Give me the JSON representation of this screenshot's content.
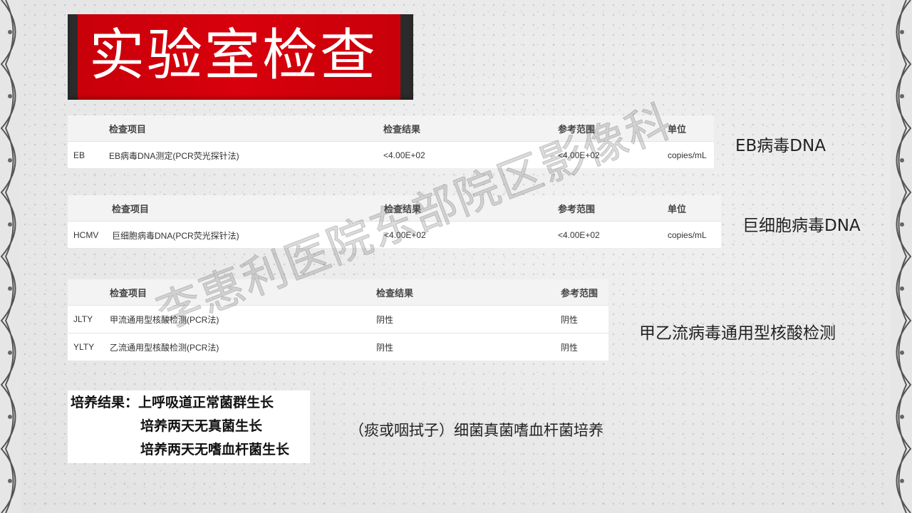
{
  "slide": {
    "title": "实验室检查",
    "watermark": "李惠利医院东部院区影像科"
  },
  "tables": {
    "eb": {
      "headers": [
        "检查项目",
        "检查结果",
        "参考范围",
        "单位"
      ],
      "rows": [
        {
          "code": "EB",
          "item": "EB病毒DNA测定(PCR荧光探针法)",
          "result": "<4.00E+02",
          "range": "<4.00E+02",
          "unit": "copies/mL"
        }
      ],
      "side_label": "EB病毒DNA"
    },
    "hcmv": {
      "headers": [
        "检查项目",
        "检查结果",
        "参考范围",
        "单位"
      ],
      "rows": [
        {
          "code": "HCMV",
          "item": "巨细胞病毒DNA(PCR荧光探针法)",
          "result": "<4.00E+02",
          "range": "<4.00E+02",
          "unit": "copies/mL"
        }
      ],
      "side_label": "巨细胞病毒DNA"
    },
    "flu": {
      "headers": [
        "检查项目",
        "检查结果",
        "参考范围"
      ],
      "rows": [
        {
          "code": "JLTY",
          "item": "甲流通用型核酸检测(PCR法)",
          "result": "阴性",
          "range": "阴性"
        },
        {
          "code": "YLTY",
          "item": "乙流通用型核酸检测(PCR法)",
          "result": "阴性",
          "range": "阴性"
        }
      ],
      "side_label": "甲乙流病毒通用型核酸检测"
    }
  },
  "culture": {
    "lines": [
      "培养结果：上呼吸道正常菌群生长",
      "培养两天无真菌生长",
      "培养两天无嗜血杆菌生长"
    ],
    "side_label": "（痰或咽拭子）细菌真菌嗜血杆菌培养"
  }
}
